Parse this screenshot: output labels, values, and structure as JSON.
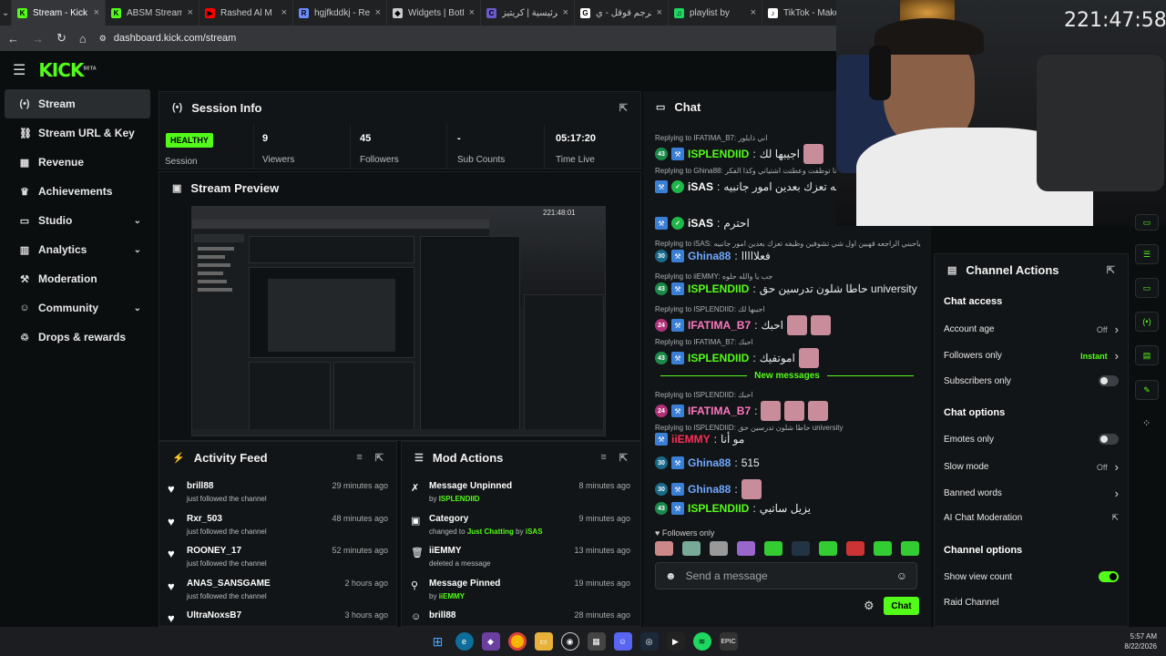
{
  "browser": {
    "tabs": [
      {
        "label": "Stream - Kick D",
        "fav": "K",
        "color": "#53fc18",
        "active": true
      },
      {
        "label": "ABSM Stream -",
        "fav": "K",
        "color": "#53fc18"
      },
      {
        "label": "Rashed Al M",
        "fav": "▶",
        "color": "#ff0000"
      },
      {
        "label": "hgjfkddkj - Re",
        "fav": "R",
        "color": "#6b8cff"
      },
      {
        "label": "Widgets | BotR",
        "fav": "◆",
        "color": "#cccccc"
      },
      {
        "label": "الرئيسية | كريتيز",
        "fav": "C",
        "color": "#6a5acd"
      },
      {
        "label": "مترجم قوقل - ي",
        "fav": "G",
        "color": "#ffffff"
      },
      {
        "label": "playlist by",
        "fav": "♫",
        "color": "#1ed760"
      },
      {
        "label": "TikTok - Make",
        "fav": "♪",
        "color": "#ffffff"
      }
    ],
    "url": "dashboard.kick.com/stream"
  },
  "logo": "KICK",
  "logo_badge": "BETA",
  "sidebar": [
    {
      "label": "Stream",
      "icon": "broadcast-icon",
      "active": true
    },
    {
      "label": "Stream URL & Key",
      "icon": "link-icon"
    },
    {
      "label": "Revenue",
      "icon": "revenue-icon"
    },
    {
      "label": "Achievements",
      "icon": "trophy-icon"
    },
    {
      "label": "Studio",
      "icon": "studio-icon",
      "chevron": true
    },
    {
      "label": "Analytics",
      "icon": "analytics-icon",
      "chevron": true
    },
    {
      "label": "Moderation",
      "icon": "hammer-icon"
    },
    {
      "label": "Community",
      "icon": "community-icon",
      "chevron": true
    },
    {
      "label": "Drops & rewards",
      "icon": "drops-icon"
    }
  ],
  "session": {
    "title": "Session Info",
    "status": "HEALTHY",
    "session_label": "Session",
    "stats": [
      {
        "value": "9",
        "label": "Viewers"
      },
      {
        "value": "45",
        "label": "Followers"
      },
      {
        "value": "-",
        "label": "Sub Counts"
      },
      {
        "value": "05:17:20",
        "label": "Time Live"
      }
    ]
  },
  "preview": {
    "title": "Stream Preview",
    "timestamp": "221:48:01"
  },
  "activity": {
    "title": "Activity Feed",
    "items": [
      {
        "name": "brill88",
        "desc": "just followed the channel",
        "time": "29 minutes ago"
      },
      {
        "name": "Rxr_503",
        "desc": "just followed the channel",
        "time": "48 minutes ago"
      },
      {
        "name": "ROONEY_17",
        "desc": "just followed the channel",
        "time": "52 minutes ago"
      },
      {
        "name": "ANAS_SANSGAME",
        "desc": "just followed the channel",
        "time": "2 hours ago"
      },
      {
        "name": "UltraNoxsB7",
        "desc": "",
        "time": "3 hours ago"
      }
    ]
  },
  "mod": {
    "title": "Mod Actions",
    "items": [
      {
        "title": "Message Unpinned",
        "pre": "by",
        "user": "ISPLENDIID",
        "time": "8 minutes ago",
        "icon": "unpin-icon"
      },
      {
        "title": "Category",
        "pre": "changed to",
        "user": "Just Chatting",
        "mid": "by",
        "user2": "iSAS",
        "time": "9 minutes ago",
        "icon": "category-icon"
      },
      {
        "title": "iiEMMY",
        "pre": "deleted a message",
        "user": "",
        "time": "13 minutes ago",
        "icon": "delete-icon"
      },
      {
        "title": "Message Pinned",
        "pre": "by",
        "user": "iiEMMY",
        "time": "19 minutes ago",
        "icon": "pin-icon"
      },
      {
        "title": "brill88",
        "pre": "",
        "user": "",
        "time": "28 minutes ago",
        "icon": "user-icon"
      }
    ]
  },
  "chat": {
    "title": "Chat",
    "replies": [
      "Replying to IFATIMA_B7: اني ذايلور",
      "Replying to Ghina88: انا توظفت وعطتت اشتياتي وكذا الفكر",
      "Replying to iSAS: ياحبني الراجعه قهبين اول شي تشوفين وظيفه تعزك بعدين امور جانبيه",
      "Replying to iiEMMY: جب يا والله حلوه",
      "Replying to ISPLENDIID: اجيبها لك",
      "Replying to IFATIMA_B7: احبك",
      "Replying to ISPLENDIID: احبك",
      "Replying to ISPLENDIID: حاطا شلون تدرسين حق university"
    ],
    "messages": [
      {
        "user": "ISPLENDIID",
        "badge": "43",
        "color": "#53fc18",
        "text": "اجيبها لك"
      },
      {
        "user": "iSAS",
        "badge": "",
        "color": "#ffffff",
        "text": "اول شي تشوفين وظيفه تعزك بعدين امور جانبيه"
      },
      {
        "user": "iSAS",
        "badge": "",
        "color": "#ffffff",
        "text": "احترم"
      },
      {
        "user": "Ghina88",
        "badge": "30",
        "color": "#6fa8ff",
        "text": "فعلااااا"
      },
      {
        "user": "ISPLENDIID",
        "badge": "43",
        "color": "#53fc18",
        "text": "حاطا شلون تدرسين حق university"
      },
      {
        "user": "IFATIMA_B7",
        "badge": "24",
        "color": "#ff77c0",
        "text": "احبك"
      },
      {
        "user": "ISPLENDIID",
        "badge": "43",
        "color": "#53fc18",
        "text": "اموتفيك"
      },
      {
        "user": "IFATIMA_B7",
        "badge": "24",
        "color": "#ff77c0",
        "text": ""
      },
      {
        "user": "iiEMMY",
        "badge": "",
        "color": "#ff2d55",
        "text": "مو أنا"
      },
      {
        "user": "Ghina88",
        "badge": "30",
        "color": "#6fa8ff",
        "text": "515"
      },
      {
        "user": "Ghina88",
        "badge": "30",
        "color": "#6fa8ff",
        "text": ""
      },
      {
        "user": "ISPLENDIID",
        "badge": "43",
        "color": "#53fc18",
        "text": "يزيل ساتبي"
      }
    ],
    "new_messages": "New messages",
    "followers_only": "Followers only",
    "placeholder": "Send a message",
    "send": "Chat"
  },
  "channel_actions": {
    "title": "Channel Actions",
    "sections": [
      {
        "heading": "Chat access"
      },
      {
        "label": "Account age",
        "value": "Off",
        "ctrl": "chevron"
      },
      {
        "label": "Followers only",
        "value": "Instant",
        "ctrl": "chevron",
        "green": true
      },
      {
        "label": "Subscribers only",
        "ctrl": "toggle",
        "on": false
      },
      {
        "heading": "Chat options"
      },
      {
        "label": "Emotes only",
        "ctrl": "toggle",
        "on": false
      },
      {
        "label": "Slow mode",
        "value": "Off",
        "ctrl": "chevron"
      },
      {
        "label": "Banned words",
        "ctrl": "chevron"
      },
      {
        "label": "AI Chat Moderation",
        "ctrl": "external"
      },
      {
        "heading": "Channel options"
      },
      {
        "label": "Show view count",
        "ctrl": "toggle",
        "on": true
      },
      {
        "label": "Raid Channel",
        "ctrl": "none"
      }
    ]
  },
  "overlay": {
    "clock": "221:47:58"
  },
  "taskbar": {
    "time": "5:57 AM",
    "date": "8/22/2026"
  },
  "colors": {
    "accent": "#53fc18",
    "panel": "#121517",
    "bg": "#0b0e0f"
  }
}
